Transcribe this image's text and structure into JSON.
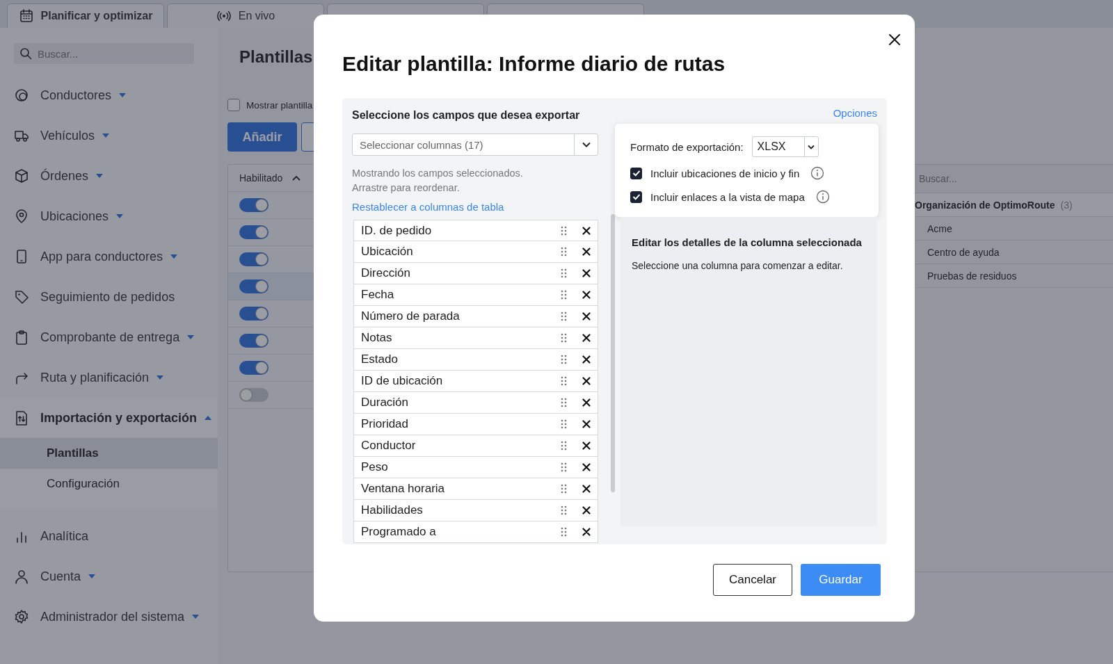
{
  "tabs": [
    {
      "kind": "labeled",
      "label": "Planificar y optimizar"
    },
    {
      "kind": "labeled",
      "label": "En vivo"
    },
    {
      "kind": "covered"
    },
    {
      "kind": "covered"
    }
  ],
  "sidebar": {
    "search": {
      "placeholder": "Buscar..."
    },
    "items": [
      {
        "label": "Conductores",
        "kind": "menu",
        "expanded": false
      },
      {
        "label": "Vehículos",
        "kind": "menu",
        "expanded": false
      },
      {
        "label": "Órdenes",
        "kind": "menu",
        "expanded": false
      },
      {
        "label": "Ubicaciones",
        "kind": "menu",
        "expanded": false
      },
      {
        "label": "App para conductores",
        "kind": "menu",
        "expanded": false
      },
      {
        "label": "Seguimiento de pedidos",
        "kind": "link",
        "expanded": false
      },
      {
        "label": "Comprobante de entrega",
        "kind": "menu",
        "expanded": false
      },
      {
        "label": "Ruta y planificación",
        "kind": "menu",
        "expanded": false
      },
      {
        "label": "Importación y exportación",
        "kind": "menu",
        "expanded": true,
        "children": [
          {
            "label": "Plantillas",
            "selected": true
          },
          {
            "label": "Configuración",
            "selected": false
          }
        ]
      },
      {
        "label": "Analítica",
        "kind": "link",
        "expanded": false
      },
      {
        "label": "Cuenta",
        "kind": "menu",
        "expanded": false
      },
      {
        "label": "Administrador del sistema",
        "kind": "menu",
        "expanded": false
      }
    ]
  },
  "main": {
    "title": "Plantillas",
    "show_checkbox": {
      "label": "Mostrar plantilla",
      "checked": false
    },
    "add_button": "Añadir",
    "table": {
      "header": "Habilitado",
      "rows": [
        {
          "enabled": true,
          "selected": false
        },
        {
          "enabled": true,
          "selected": false
        },
        {
          "enabled": true,
          "selected": false
        },
        {
          "enabled": true,
          "selected": true
        },
        {
          "enabled": true,
          "selected": false
        },
        {
          "enabled": true,
          "selected": false
        },
        {
          "enabled": true,
          "selected": false
        },
        {
          "enabled": false,
          "selected": false
        }
      ]
    },
    "tree_panel": {
      "search": {
        "placeholder": "Buscar..."
      },
      "group": {
        "label": "Organización de OptimoRoute",
        "count": "(3)"
      },
      "children": [
        "Acme",
        "Centro de ayuda",
        "Pruebas de residuos"
      ]
    }
  },
  "modal": {
    "title": "Editar plantilla: Informe diario de rutas",
    "section_title": "Seleccione los campos que desea exportar",
    "options_link": "Opciones",
    "column_select": {
      "placeholder": "Seleccionar columnas (17)"
    },
    "hint_lines": [
      "Mostrando los campos seleccionados.",
      "Arrastre para reordenar."
    ],
    "reset_link": "Restablecer a columnas de tabla",
    "columns": [
      "ID. de pedido",
      "Ubicación",
      "Dirección",
      "Fecha",
      "Número de parada",
      "Notas",
      "Estado",
      "ID de ubicación",
      "Duración",
      "Prioridad",
      "Conductor",
      "Peso",
      "Ventana horaria",
      "Habilidades",
      "Programado a"
    ],
    "options": {
      "format_label": "Formato de exportación:",
      "format_value": "XLSX",
      "checkboxes": [
        {
          "label": "Incluir ubicaciones de inicio y fin",
          "checked": true
        },
        {
          "label": "Incluir enlaces a la vista de mapa",
          "checked": true
        }
      ]
    },
    "detail_title": "Editar los detalles de la columna seleccionada",
    "detail_hint": "Seleccione una columna para comenzar a editar.",
    "buttons": {
      "cancel": "Cancelar",
      "save": "Guardar"
    }
  }
}
